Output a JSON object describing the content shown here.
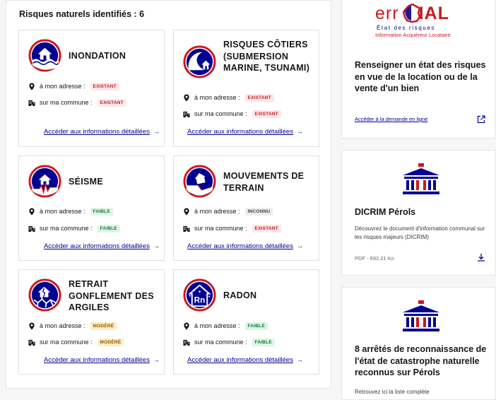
{
  "section_title": "Risques naturels identifiés : 6",
  "labels": {
    "address": "à mon adresse :",
    "commune": "sur ma commune :",
    "details_link": "Accéder aux informations détaillées",
    "arrow": "→"
  },
  "risks": [
    {
      "name": "INONDATION",
      "icon": "flood-icon",
      "address": "EXISTANT",
      "commune": "EXISTANT"
    },
    {
      "name": "RISQUES CÔTIERS (SUBMERSION MARINE, TSUNAMI)",
      "icon": "coastal-wave-icon",
      "address": "EXISTANT",
      "commune": "EXISTANT"
    },
    {
      "name": "SÉISME",
      "icon": "earthquake-icon",
      "address": "FAIBLE",
      "commune": "FAIBLE"
    },
    {
      "name": "MOUVEMENTS DE TERRAIN",
      "icon": "landslide-icon",
      "address": "INCONNU",
      "commune": "EXISTANT"
    },
    {
      "name": "RETRAIT GONFLEMENT DES ARGILES",
      "icon": "clay-shrink-icon",
      "address": "MODÉRÉ",
      "commune": "MODÉRÉ"
    },
    {
      "name": "RADON",
      "icon": "radon-icon",
      "address": "FAIBLE",
      "commune": "FAIBLE"
    }
  ],
  "badge_colors": {
    "existant": "#c9191e",
    "faible": "#18753c",
    "modere": "#8d5a00",
    "inconnu": "#3a3a3a",
    "accent": "#000091"
  },
  "errial_card": {
    "logo_prefix": "err",
    "logo_suffix": "IAL",
    "logo_line1": "État des risques",
    "logo_line2": "Information Acquéreur Locataire",
    "title": "Renseigner un état des risques en vue de la location ou de la vente d'un bien",
    "link": "Accéder à la demande en ligne"
  },
  "dicrim_card": {
    "title": "DICRIM Pérols",
    "description": "Découvrez le document d'information communal sur les risques majeurs (DICRIM)",
    "meta": "PDF - 692,21 Ko"
  },
  "arretes_card": {
    "title": "8 arrêtés de reconnaissance de l'état de catastrophe naturelle reconnus sur Pérols",
    "description": "Retrouvez ici la liste complète"
  }
}
